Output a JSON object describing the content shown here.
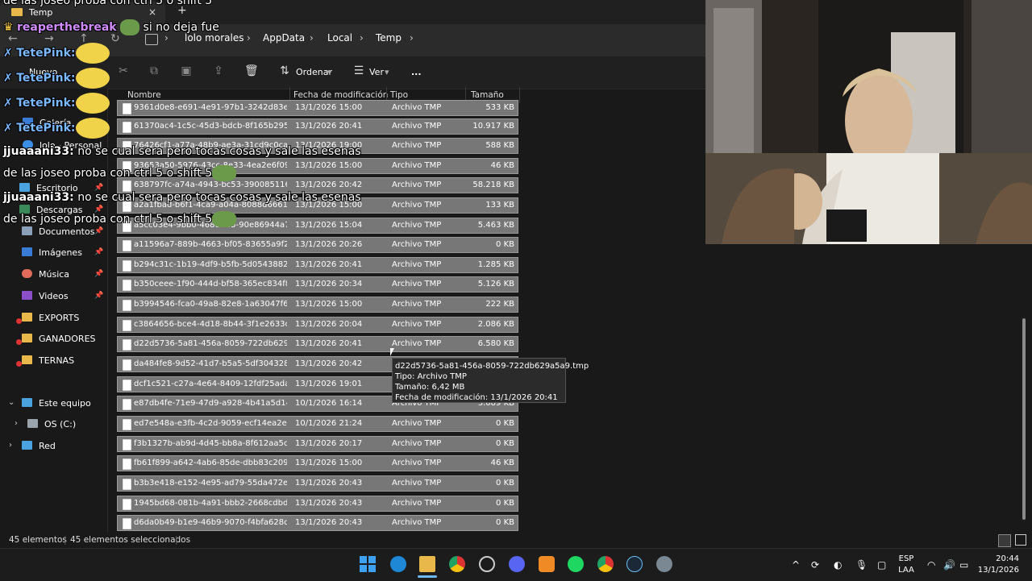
{
  "window": {
    "tab_title": "Temp",
    "tab_close": "×",
    "new_tab": "+"
  },
  "breadcrumb": [
    {
      "label": "lolo morales"
    },
    {
      "label": "AppData"
    },
    {
      "label": "Local"
    },
    {
      "label": "Temp"
    }
  ],
  "breadcrumb_separator": "›",
  "toolbar": {
    "new_label": "Nuevo",
    "sort_label": "Ordenar",
    "view_label": "Ver",
    "more_label": "..."
  },
  "sidebar": {
    "items": [
      {
        "label": "Galería",
        "icon": "image-icon"
      },
      {
        "label": "lolo - Personal",
        "icon": "cloud-icon"
      },
      {
        "label": "Escritorio",
        "icon": "desktop-icon",
        "pinned": true
      },
      {
        "label": "Descargas",
        "icon": "download-icon",
        "pinned": true
      },
      {
        "label": "Documentos",
        "icon": "document-icon",
        "pinned": true
      },
      {
        "label": "Imágenes",
        "icon": "image-icon",
        "pinned": true
      },
      {
        "label": "Música",
        "icon": "music-icon",
        "pinned": true
      },
      {
        "label": "Videos",
        "icon": "video-icon",
        "pinned": true
      },
      {
        "label": "EXPORTS",
        "icon": "folder-icon"
      },
      {
        "label": "GANADORES",
        "icon": "folder-icon"
      },
      {
        "label": "TERNAS",
        "icon": "folder-icon"
      },
      {
        "label": "Este equipo",
        "icon": "computer-icon"
      },
      {
        "label": "OS (C:)",
        "icon": "drive-icon"
      },
      {
        "label": "Red",
        "icon": "network-icon"
      }
    ]
  },
  "columns": {
    "name": "Nombre",
    "date": "Fecha de modificación",
    "type": "Tipo",
    "size": "Tamaño"
  },
  "files": [
    {
      "name": "9361d0e8-e691-4e91-97b1-3242d83e50...",
      "date": "13/1/2026 15:00",
      "type": "Archivo TMP",
      "size": "533 KB"
    },
    {
      "name": "61370ac4-1c5c-45d3-bdcb-8f165b29578...",
      "date": "13/1/2026 20:41",
      "type": "Archivo TMP",
      "size": "10.917 KB"
    },
    {
      "name": "76426cf1-a77a-48b9-ae3a-31cd9c0ca7e...",
      "date": "13/1/2026 19:00",
      "type": "Archivo TMP",
      "size": "588 KB"
    },
    {
      "name": "93653a50-5976-43cc-8e33-4ea2e6f096...",
      "date": "13/1/2026 15:00",
      "type": "Archivo TMP",
      "size": "46 KB"
    },
    {
      "name": "638797fc-a74a-4943-bc53-390085116da...",
      "date": "13/1/2026 20:42",
      "type": "Archivo TMP",
      "size": "58.218 KB"
    },
    {
      "name": "a2a1fbad-b6f1-4ca9-a04a-8088d666138...",
      "date": "13/1/2026 15:00",
      "type": "Archivo TMP",
      "size": "133 KB"
    },
    {
      "name": "a5cc03e4-9bb0-4680-bf5-90e86944a7c...",
      "date": "13/1/2026 15:04",
      "type": "Archivo TMP",
      "size": "5.463 KB"
    },
    {
      "name": "a11596a7-889b-4663-bf05-83655a9f2ac...",
      "date": "13/1/2026 20:26",
      "type": "Archivo TMP",
      "size": "0 KB"
    },
    {
      "name": "b294c31c-1b19-4df9-b5fb-5d0543882d8...",
      "date": "13/1/2026 20:41",
      "type": "Archivo TMP",
      "size": "1.285 KB"
    },
    {
      "name": "b350ceee-1f90-444d-bf58-365ec834f842...",
      "date": "13/1/2026 20:34",
      "type": "Archivo TMP",
      "size": "5.126 KB"
    },
    {
      "name": "b3994546-fca0-49a8-82e8-1a63047f6e6c...",
      "date": "13/1/2026 15:00",
      "type": "Archivo TMP",
      "size": "222 KB"
    },
    {
      "name": "c3864656-bce4-4d18-8b44-3f1e2633c63...",
      "date": "13/1/2026 20:04",
      "type": "Archivo TMP",
      "size": "2.086 KB"
    },
    {
      "name": "d22d5736-5a81-456a-8059-722db629a5...",
      "date": "13/1/2026 20:41",
      "type": "Archivo TMP",
      "size": "6.580 KB"
    },
    {
      "name": "da484fe8-9d52-41d7-b5a5-5df304328a3...",
      "date": "13/1/2026 20:42",
      "type": "Archivo TMP",
      "size": ""
    },
    {
      "name": "dcf1c521-c27a-4e64-8409-12fdf25adab1...",
      "date": "13/1/2026 19:01",
      "type": "Archivo TMP",
      "size": ""
    },
    {
      "name": "e87db4fe-71e9-47d9-a928-4b41a5d14d...",
      "date": "10/1/2026 16:14",
      "type": "Archivo TMP",
      "size": "3.089 KB"
    },
    {
      "name": "ed7e548a-e3fb-4c2d-9059-ecf14ea2e75...",
      "date": "10/1/2026 21:24",
      "type": "Archivo TMP",
      "size": "0 KB"
    },
    {
      "name": "f3b1327b-ab9d-4d45-bb8a-8f612aa5c08...",
      "date": "13/1/2026 20:17",
      "type": "Archivo TMP",
      "size": "0 KB"
    },
    {
      "name": "fb61f899-a642-4ab6-85de-dbb83c20996...",
      "date": "13/1/2026 15:00",
      "type": "Archivo TMP",
      "size": "46 KB"
    },
    {
      "name": "b3b3e418-e152-4e95-ad79-55da472edd...",
      "date": "13/1/2026 20:43",
      "type": "Archivo TMP",
      "size": "0 KB"
    },
    {
      "name": "1945bd68-081b-4a91-bbb2-2668cdbdb0...",
      "date": "13/1/2026 20:43",
      "type": "Archivo TMP",
      "size": "0 KB"
    },
    {
      "name": "d6da0b49-b1e9-46b9-9070-f4bfa628dd...",
      "date": "13/1/2026 20:43",
      "type": "Archivo TMP",
      "size": "0 KB"
    }
  ],
  "tooltip": {
    "line1": "d22d5736-5a81-456a-8059-722db629a5a9.tmp",
    "line2": "Tipo: Archivo TMP",
    "line3": "Tamaño: 6,42 MB",
    "line4": "Fecha de modificación: 13/1/2026 20:41"
  },
  "status": {
    "count": "45 elementos",
    "selected": "45 elementos seleccionados",
    "separator": "|"
  },
  "chat": [
    {
      "text": "de las joseo proba con ctrl 5 o shift 5"
    },
    {
      "user": "reaperthebreak",
      "user_color": "#d08cff",
      "text": "si no deja fue"
    },
    {
      "user": "TetePink:",
      "user_color": "#7ab8ff",
      "text": ""
    },
    {
      "user": "TetePink:",
      "user_color": "#7ab8ff",
      "text": ""
    },
    {
      "user": "TetePink:",
      "user_color": "#7ab8ff",
      "text": ""
    },
    {
      "user": "TetePink:",
      "user_color": "#7ab8ff",
      "text": ""
    },
    {
      "user": "jjuaaani33:",
      "user_color": "#ffffff",
      "text": "no se cual sera pero tocas cosas y sale las esenas"
    },
    {
      "text": "de las joseo proba con ctrl 5 o shift 5"
    },
    {
      "user": "jjuaaani33:",
      "user_color": "#ffffff",
      "text": "no se cual sera pero tocas cosas y sale las esenas"
    },
    {
      "text": "de las joseo proba con ctrl 5 o shift 5"
    }
  ],
  "tray": {
    "lang_top": "ESP",
    "lang_bottom": "LAA",
    "time": "20:44",
    "date": "13/1/2026",
    "chevron": "^"
  },
  "colors": {
    "selection_row": "#777777",
    "folder": "#e8b84a",
    "tetepink": "#7ab8ff"
  }
}
